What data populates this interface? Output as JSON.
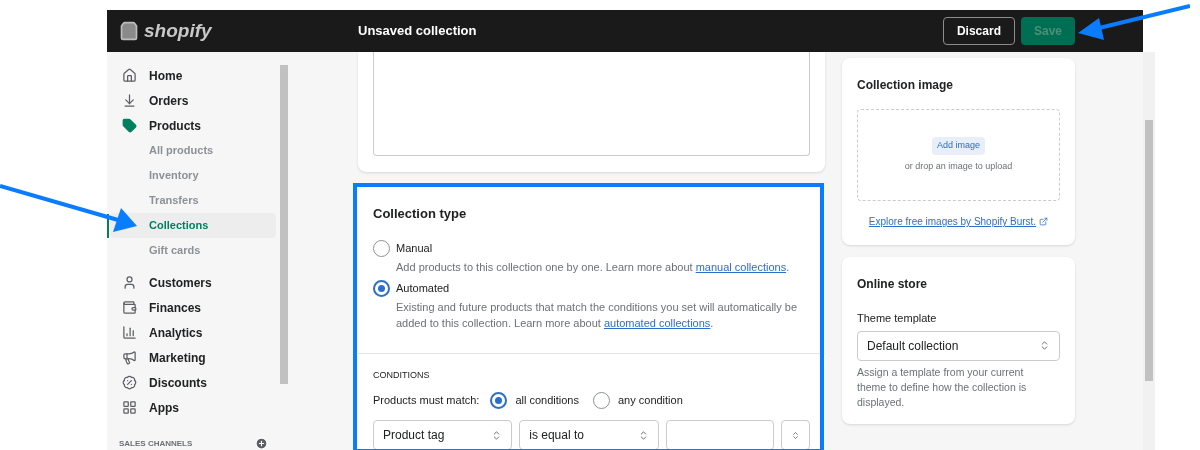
{
  "top_bar": {
    "logo_text": "shopify",
    "title": "Unsaved collection",
    "buttons": [
      {
        "label": "Discard",
        "kind": "secondary",
        "disabled": false
      },
      {
        "label": "Save",
        "kind": "primary",
        "disabled": true
      }
    ]
  },
  "sidebar": {
    "items": [
      {
        "label": "Home",
        "selected": false
      },
      {
        "label": "Orders",
        "selected": false
      },
      {
        "label": "Products",
        "selected": true,
        "children": [
          {
            "label": "All products",
            "selected": false
          },
          {
            "label": "Inventory",
            "selected": false
          },
          {
            "label": "Transfers",
            "selected": false
          },
          {
            "label": "Collections",
            "selected": true
          },
          {
            "label": "Gift cards",
            "selected": false
          }
        ]
      },
      {
        "label": "Customers",
        "selected": false
      },
      {
        "label": "Finances",
        "selected": false
      },
      {
        "label": "Analytics",
        "selected": false
      },
      {
        "label": "Marketing",
        "selected": false
      },
      {
        "label": "Discounts",
        "selected": false
      },
      {
        "label": "Apps",
        "selected": false
      }
    ],
    "section_heading": "SALES CHANNELS"
  },
  "collection_type": {
    "title": "Collection type",
    "options": [
      {
        "label": "Manual",
        "selected": false,
        "description": "Add products to this collection one by one. Learn more about ",
        "link": "manual collections",
        "after": "."
      },
      {
        "label": "Automated",
        "selected": true,
        "description": "Existing and future products that match the conditions you set will automatically be added to this collection. Learn more about ",
        "link": "automated collections",
        "after": "."
      }
    ],
    "conditions": {
      "heading": "CONDITIONS",
      "match_label": "Products must match:",
      "match_options": [
        {
          "label": "all conditions",
          "selected": true
        },
        {
          "label": "any condition",
          "selected": false
        }
      ],
      "rule": {
        "field": "Product tag",
        "operator": "is equal to"
      }
    }
  },
  "collection_image": {
    "title": "Collection image",
    "add_button": "Add image",
    "hint": "or drop an image to upload",
    "link": "Explore free images by Shopify Burst."
  },
  "online_store": {
    "title": "Online store",
    "field_label": "Theme template",
    "select_value": "Default collection",
    "help": "Assign a template from your current theme to define how the collection is displayed."
  }
}
